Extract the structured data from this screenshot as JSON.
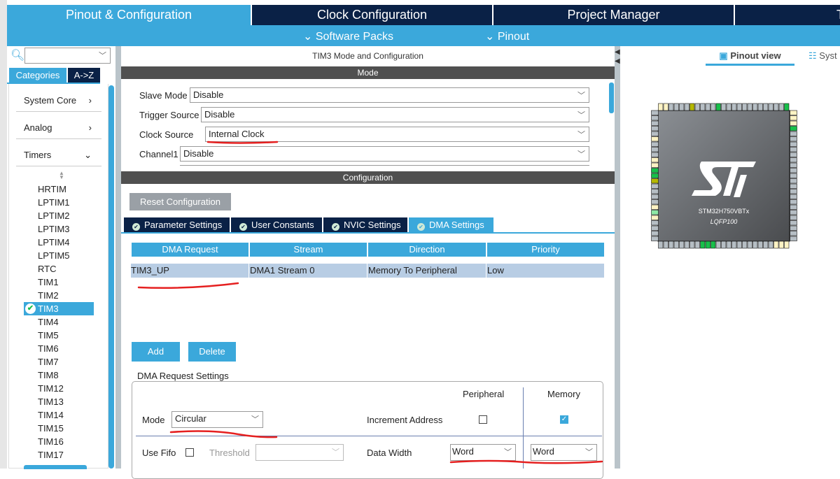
{
  "top_tabs": [
    {
      "label": "Pinout & Configuration",
      "active": true
    },
    {
      "label": "Clock Configuration"
    },
    {
      "label": "Project Manager"
    },
    {
      "label": "T"
    }
  ],
  "sub_menu": {
    "software_packs": "Software Packs",
    "pinout": "Pinout"
  },
  "sidebar": {
    "search_value": "",
    "tabs": {
      "categories": "Categories",
      "az": "A->Z"
    },
    "categories": [
      {
        "label": "System Core",
        "chevron": ">"
      },
      {
        "label": "Analog",
        "chevron": ">"
      },
      {
        "label": "Timers",
        "chevron": "v"
      }
    ],
    "timers": [
      "HRTIM",
      "LPTIM1",
      "LPTIM2",
      "LPTIM3",
      "LPTIM4",
      "LPTIM5",
      "RTC",
      "TIM1",
      "TIM2",
      "TIM3",
      "TIM4",
      "TIM5",
      "TIM6",
      "TIM7",
      "TIM8",
      "TIM12",
      "TIM13",
      "TIM14",
      "TIM15",
      "TIM16",
      "TIM17"
    ],
    "selected": "TIM3"
  },
  "main": {
    "title": "TIM3 Mode and Configuration",
    "mode_header": "Mode",
    "mode_fields": [
      {
        "label": "Slave Mode",
        "value": "Disable"
      },
      {
        "label": "Trigger Source",
        "value": "Disable"
      },
      {
        "label": "Clock Source",
        "value": "Internal Clock"
      },
      {
        "label": "Channel1",
        "value": "Disable"
      }
    ],
    "config_header": "Configuration",
    "reset_button": "Reset Configuration",
    "tabs": [
      "Parameter Settings",
      "User Constants",
      "NVIC Settings",
      "DMA Settings"
    ],
    "active_tab": "DMA Settings",
    "dma_table": {
      "columns": [
        "DMA Request",
        "Stream",
        "Direction",
        "Priority"
      ],
      "rows": [
        [
          "TIM3_UP",
          "DMA1 Stream 0",
          "Memory To Peripheral",
          "Low"
        ]
      ]
    },
    "add_button": "Add",
    "delete_button": "Delete",
    "request_settings": {
      "legend": "DMA Request Settings",
      "peripheral": "Peripheral",
      "memory": "Memory",
      "mode_label": "Mode",
      "mode_value": "Circular",
      "increment_label": "Increment Address",
      "increment_peripheral": false,
      "increment_memory": true,
      "fifo_label": "Use Fifo",
      "use_fifo": false,
      "threshold_label": "Threshold",
      "threshold_value": "",
      "data_width_label": "Data Width",
      "peripheral_width": "Word",
      "memory_width": "Word"
    }
  },
  "right": {
    "pinout_view": "Pinout view",
    "system_view": "Syst",
    "chip_name": "STM32H750VBTx",
    "package": "LQFP100"
  },
  "colors": {
    "accent": "#3ba8db",
    "navy": "#0a2146",
    "annotation": "#e52020",
    "pin_green": "#17c04a"
  }
}
